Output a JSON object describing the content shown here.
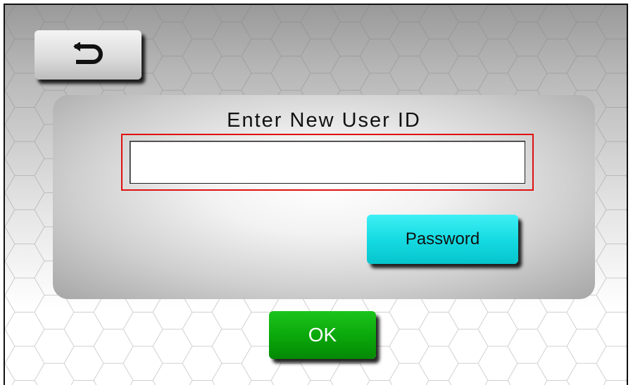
{
  "panel": {
    "title": "Enter New User ID"
  },
  "userid_input": {
    "value": "",
    "placeholder": ""
  },
  "buttons": {
    "password_label": "Password",
    "ok_label": "OK"
  },
  "icons": {
    "back": "back-arrow-icon"
  },
  "colors": {
    "input_highlight": "#e01010",
    "password_button": "#16dbe2",
    "ok_button": "#0aa60a"
  }
}
